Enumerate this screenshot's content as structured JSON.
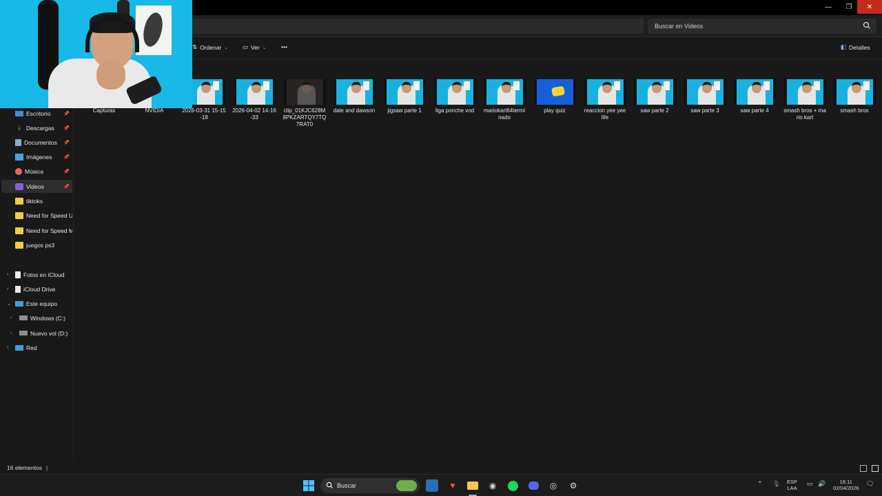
{
  "window": {
    "minimize": "—",
    "maximize": "❐",
    "close": "✕"
  },
  "search": {
    "placeholder": "Buscar en Videos"
  },
  "toolbar": {
    "sort_label": "Ordenar",
    "view_label": "Ver",
    "more_label": "•••",
    "details_label": "Detalles"
  },
  "nav": {
    "quick_access": [
      {
        "label": "Escritorio",
        "icon": "desktop-icon",
        "pinned": true
      },
      {
        "label": "Descargas",
        "icon": "download-icon",
        "pinned": true
      },
      {
        "label": "Documentos",
        "icon": "documents-icon",
        "pinned": true
      },
      {
        "label": "Imágenes",
        "icon": "pictures-icon",
        "pinned": true
      },
      {
        "label": "Música",
        "icon": "music-icon",
        "pinned": true
      },
      {
        "label": "Videos",
        "icon": "videos-icon",
        "pinned": true,
        "selected": true
      },
      {
        "label": "tiktoks",
        "icon": "folder-icon"
      },
      {
        "label": "Need for Speed Un",
        "icon": "folder-icon"
      },
      {
        "label": "Need for Speed Mo",
        "icon": "folder-icon"
      },
      {
        "label": "juegos ps3",
        "icon": "folder-icon"
      }
    ],
    "locations": [
      {
        "label": "Fotos en iCloud",
        "icon": "document-icon"
      },
      {
        "label": "iCloud Drive",
        "icon": "document-icon"
      },
      {
        "label": "Este equipo",
        "icon": "computer-icon",
        "expanded": true
      },
      {
        "label": "Windows (C:)",
        "icon": "drive-icon"
      },
      {
        "label": "Nuevo vol (D:)",
        "icon": "drive-icon"
      },
      {
        "label": "Red",
        "icon": "network-icon"
      }
    ]
  },
  "files": [
    {
      "label": "Capturas",
      "type": "folder"
    },
    {
      "label": "NVIDIA",
      "type": "folder"
    },
    {
      "label": "2026-03-31 15-15-18",
      "type": "video"
    },
    {
      "label": "2026-04-02 14-16-33",
      "type": "video"
    },
    {
      "label": "clip_01KJC628M8PKZARTQY7TQ7RAT0",
      "type": "video-dark"
    },
    {
      "label": "dale and dawson",
      "type": "video"
    },
    {
      "label": "jigsaw parte 1",
      "type": "video"
    },
    {
      "label": "liga ponche vod",
      "type": "video"
    },
    {
      "label": "mariokart64terminado",
      "type": "video"
    },
    {
      "label": "play quiz",
      "type": "video-quiz"
    },
    {
      "label": "reaccion yee yee life",
      "type": "video"
    },
    {
      "label": "saw parte 2",
      "type": "video"
    },
    {
      "label": "saw parte 3",
      "type": "video"
    },
    {
      "label": "saw parte 4",
      "type": "video"
    },
    {
      "label": "smash bros + mario kart",
      "type": "video"
    },
    {
      "label": "smash bros",
      "type": "video"
    }
  ],
  "status": {
    "item_count": "16 elementos"
  },
  "taskbar": {
    "search_label": "Buscar",
    "language": "ESP",
    "layout": "LAA",
    "time": "16:11",
    "date": "02/04/2026"
  }
}
